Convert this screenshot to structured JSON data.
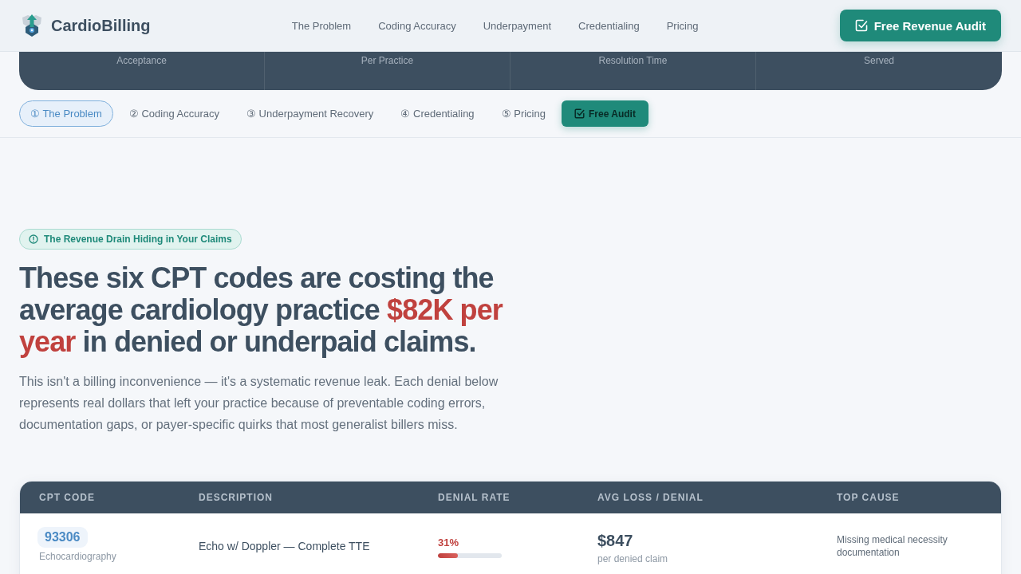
{
  "header": {
    "brand": "CardioBilling",
    "nav": [
      {
        "label": "The Problem"
      },
      {
        "label": "Coding Accuracy"
      },
      {
        "label": "Underpayment"
      },
      {
        "label": "Credentialing"
      },
      {
        "label": "Pricing"
      }
    ],
    "cta": "Free Revenue Audit"
  },
  "stats": [
    {
      "label": "Acceptance"
    },
    {
      "label": "Per Practice"
    },
    {
      "label": "Resolution Time"
    },
    {
      "label": "Served"
    }
  ],
  "section_nav": {
    "items": [
      {
        "label": "① The Problem",
        "selected": true
      },
      {
        "label": "② Coding Accuracy",
        "selected": false
      },
      {
        "label": "③ Underpayment Recovery",
        "selected": false
      },
      {
        "label": "④ Credentialing",
        "selected": false
      },
      {
        "label": "⑤ Pricing",
        "selected": false
      }
    ],
    "cta": "Free Audit"
  },
  "hero": {
    "badge": "The Revenue Drain Hiding in Your Claims",
    "heading": "These six CPT codes are costing the average cardiology practice **$82K per year** in denied or underpaid claims.",
    "intro": "This isn't a billing inconvenience — it's a systematic revenue leak. Each denial below represents real dollars that left your practice because of preventable coding errors, documentation gaps, or payer-specific quirks that most generalist billers miss."
  },
  "table": {
    "columns": [
      "CPT CODE",
      "DESCRIPTION",
      "DENIAL RATE",
      "AVG LOSS / DENIAL",
      "TOP CAUSE"
    ],
    "rows": [
      {
        "code": "93306",
        "category": "Echocardiography",
        "description": "Echo w/ Doppler — Complete TTE",
        "denial_rate": "31%",
        "level": 0.31,
        "avg_loss": "$847",
        "loss_note": "per denied claim",
        "top_cause": "Missing medical necessity documentation"
      }
    ]
  }
}
